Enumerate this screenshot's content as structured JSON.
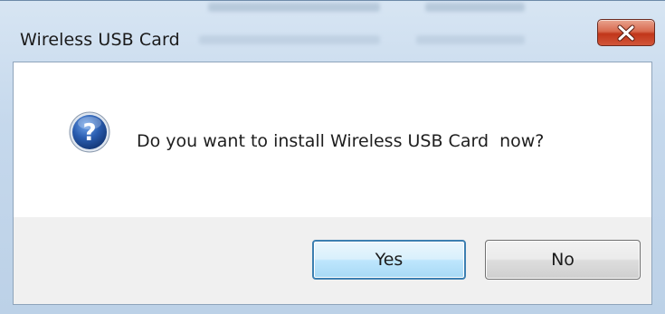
{
  "dialog": {
    "title": "Wireless USB Card",
    "message": "Do you want to install Wireless USB Card  now?",
    "icon": "question-icon",
    "buttons": {
      "yes_label": "Yes",
      "no_label": "No"
    },
    "close_icon": "close-icon"
  },
  "colors": {
    "close_button": "#c9462a",
    "default_button_border": "#3c7fb1",
    "question_icon": "#2a5db0"
  }
}
